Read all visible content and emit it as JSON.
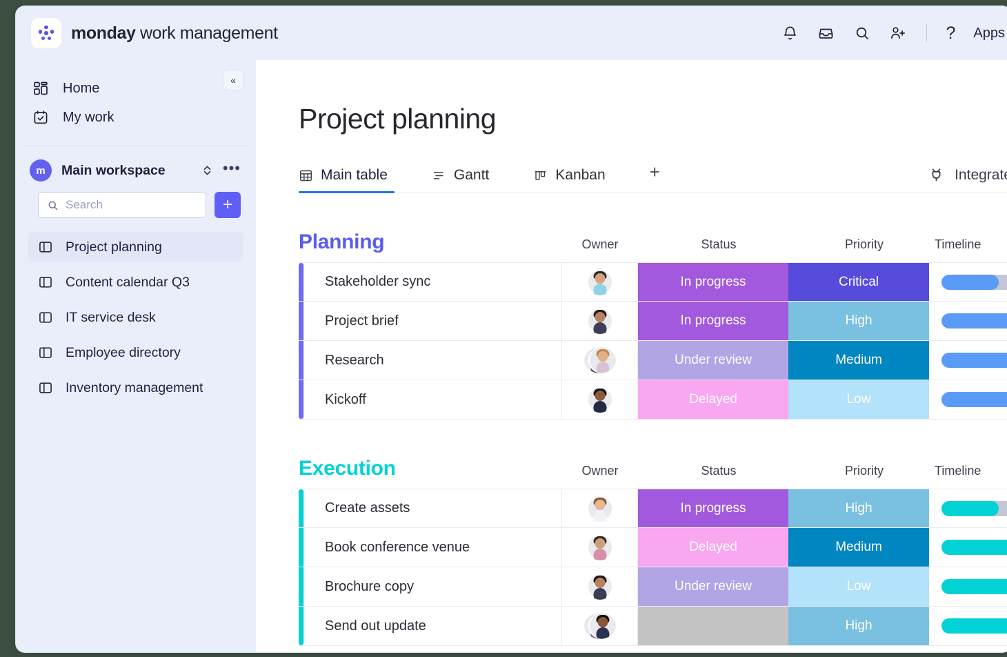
{
  "app": {
    "brand_bold": "monday",
    "brand_rest": " work management",
    "logo_icon": "monday-dots-logo"
  },
  "topbar": {
    "icons": [
      {
        "name": "notifications-bell-icon",
        "label": "Notifications"
      },
      {
        "name": "inbox-icon",
        "label": "Inbox"
      },
      {
        "name": "search-icon",
        "label": "Search"
      },
      {
        "name": "invite-member-icon",
        "label": "Invite members"
      }
    ],
    "help_label": "?",
    "apps_label": "Apps"
  },
  "sidebar": {
    "collapse_label": "«",
    "nav": [
      {
        "label": "Home",
        "icon": "home-grid-icon"
      },
      {
        "label": "My work",
        "icon": "my-work-calendar-icon"
      }
    ],
    "workspace": {
      "initial": "m",
      "name": "Main workspace",
      "more_label": "•••"
    },
    "search": {
      "placeholder": "Search",
      "value": "",
      "icon": "search-icon"
    },
    "add_button_label": "+",
    "boards": [
      {
        "label": "Project planning",
        "active": true
      },
      {
        "label": "Content calendar Q3",
        "active": false
      },
      {
        "label": "IT service desk",
        "active": false
      },
      {
        "label": "Employee directory",
        "active": false
      },
      {
        "label": "Inventory management",
        "active": false
      }
    ]
  },
  "main": {
    "title": "Project planning",
    "tabs": [
      {
        "label": "Main table",
        "icon": "table-grid-icon",
        "active": true
      },
      {
        "label": "Gantt",
        "icon": "gantt-bars-icon",
        "active": false
      },
      {
        "label": "Kanban",
        "icon": "kanban-columns-icon",
        "active": false
      }
    ],
    "add_tab_label": "+",
    "integrate_label": "Integrate",
    "integrate_icon": "plug-integration-icon",
    "columns": [
      "Owner",
      "Status",
      "Priority",
      "Timeline"
    ]
  },
  "colors": {
    "group_planning": "#5b5bf0",
    "group_execution": "#00d2d6",
    "accent_planning": "#6c6cf0",
    "accent_execution": "#00d2d6",
    "status_in_progress": "#a259dd",
    "status_under_review": "#b3a4e6",
    "status_delayed": "#f9a7f1",
    "status_empty": "#c4c4c4",
    "priority_critical": "#564bdb",
    "priority_high": "#7ac0e0",
    "priority_medium": "#0086c0",
    "priority_low": "#b3e2fb",
    "timeline_track": "#c3c6d4",
    "brand_purple": "#5f5ff5",
    "tab_underline": "#1f76e5"
  },
  "groups": [
    {
      "name": "Planning",
      "color": "#5b5bf0",
      "accent": "#6c6cf0",
      "timeline_color": "#5b9bf8",
      "rows": [
        {
          "name": "Stakeholder sync",
          "owner": {
            "name": "avatar-person-1",
            "skin": "#d8a27d",
            "hair": "#2a2a2a",
            "shirt": "#8fd3e8",
            "pair": false
          },
          "status": "In progress",
          "status_color": "#a259dd",
          "priority": "Critical",
          "priority_color": "#564bdb",
          "timeline_pct": 36
        },
        {
          "name": "Project brief",
          "owner": {
            "name": "avatar-person-2",
            "skin": "#b98163",
            "hair": "#271a15",
            "shirt": "#3c3f55",
            "pair": false
          },
          "status": "In progress",
          "status_color": "#a259dd",
          "priority": "High",
          "priority_color": "#7ac0e0",
          "timeline_pct": 100
        },
        {
          "name": "Research",
          "owner": {
            "name": "avatar-person-pair-1",
            "skin": "#c99268",
            "hair": "#1f1b18",
            "shirt": "#4a4f6b",
            "skin2": "#e2b088",
            "hair2": "#c08a4a",
            "shirt2": "#d8c3d6",
            "pair": true
          },
          "status": "Under review",
          "status_color": "#b3a4e6",
          "priority": "Medium",
          "priority_color": "#0086c0",
          "timeline_pct": 79
        },
        {
          "name": "Kickoff",
          "owner": {
            "name": "avatar-person-3",
            "skin": "#8d5a3b",
            "hair": "#14100e",
            "shirt": "#232a45",
            "pair": false
          },
          "status": "Delayed",
          "status_color": "#f9a7f1",
          "priority": "Low",
          "priority_color": "#b3e2fb",
          "timeline_pct": 100
        }
      ]
    },
    {
      "name": "Execution",
      "color": "#00d2d6",
      "accent": "#00d2d6",
      "timeline_color": "#00d2d6",
      "rows": [
        {
          "name": "Create assets",
          "owner": {
            "name": "avatar-person-4",
            "skin": "#e6b994",
            "hair": "#8a5a33",
            "shirt": "#f2f2f4",
            "pair": false
          },
          "status": "In progress",
          "status_color": "#a259dd",
          "priority": "High",
          "priority_color": "#7ac0e0",
          "timeline_pct": 36
        },
        {
          "name": "Book conference venue",
          "owner": {
            "name": "avatar-person-5",
            "skin": "#caa07a",
            "hair": "#3a2b20",
            "shirt": "#d88fa8",
            "pair": false
          },
          "status": "Delayed",
          "status_color": "#f9a7f1",
          "priority": "Medium",
          "priority_color": "#0086c0",
          "timeline_pct": 100
        },
        {
          "name": "Brochure copy",
          "owner": {
            "name": "avatar-person-6",
            "skin": "#b9825f",
            "hair": "#211713",
            "shirt": "#3b3e52",
            "pair": false
          },
          "status": "Under review",
          "status_color": "#b3a4e6",
          "priority": "Low",
          "priority_color": "#b3e2fb",
          "timeline_pct": 79
        },
        {
          "name": "Send out update",
          "owner": {
            "name": "avatar-person-pair-2",
            "skin": "#d9a882",
            "hair": "#2c2623",
            "shirt": "#6b6f86",
            "skin2": "#8a5436",
            "hair2": "#120e0c",
            "shirt2": "#2b3150",
            "pair": true
          },
          "status": "",
          "status_color": "#c4c4c4",
          "priority": "High",
          "priority_color": "#7ac0e0",
          "timeline_pct": 100
        }
      ]
    }
  ]
}
